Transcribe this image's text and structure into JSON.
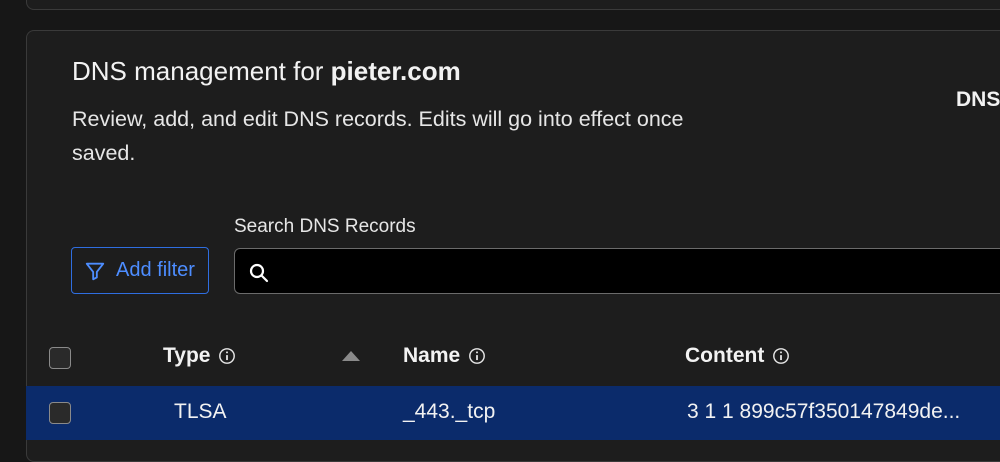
{
  "header": {
    "title_prefix": "DNS management for ",
    "domain": "pieter.com",
    "description": "Review, add, and edit DNS records. Edits will go into effect once saved.",
    "right_cut_text": "DNS"
  },
  "filter": {
    "add_filter_label": "Add filter"
  },
  "search": {
    "label": "Search DNS Records",
    "value": "",
    "placeholder": ""
  },
  "table": {
    "columns": [
      {
        "label": "Type",
        "has_info": true,
        "sorted": "ascending"
      },
      {
        "label": "Name",
        "has_info": true
      },
      {
        "label": "Content",
        "has_info": true
      }
    ],
    "rows": [
      {
        "type": "TLSA",
        "name": "_443._tcp",
        "content": "3 1 1 899c57f350147849de...",
        "selected": true
      }
    ]
  },
  "colors": {
    "accent": "#4d8dff",
    "row_highlight": "#0b2b6b",
    "background": "#171717",
    "card": "#1d1d1d"
  },
  "icons": [
    "filter-icon",
    "search-icon",
    "info-icon",
    "sort-ascending-icon"
  ]
}
